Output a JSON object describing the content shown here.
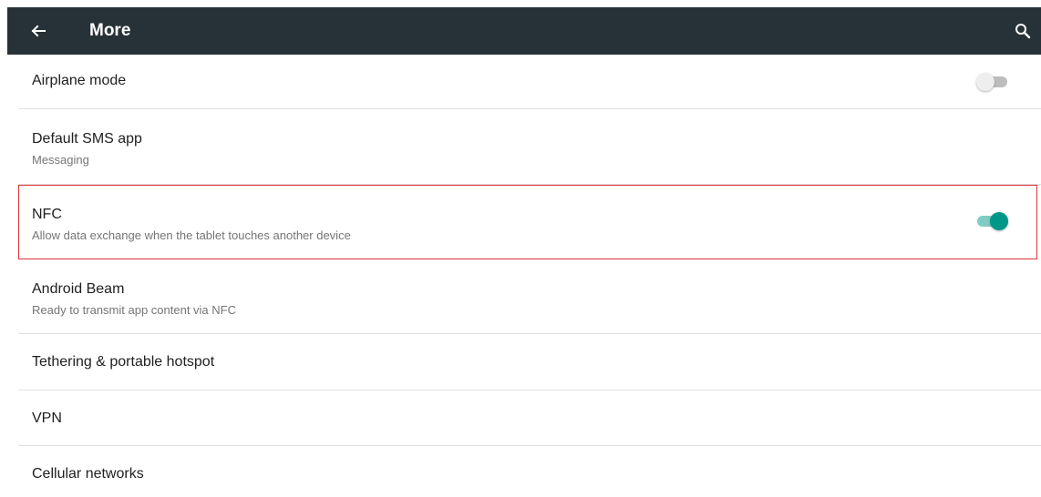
{
  "toolbar": {
    "title": "More",
    "back_icon": "arrow-back-icon",
    "search_icon": "search-icon",
    "background_color": "#263238"
  },
  "items": [
    {
      "title": "Airplane mode",
      "subtitle": "",
      "toggle": "off"
    },
    {
      "title": "Default SMS app",
      "subtitle": "Messaging"
    },
    {
      "title": "NFC",
      "subtitle": "Allow data exchange when the tablet touches another device",
      "toggle": "on"
    },
    {
      "title": "Android Beam",
      "subtitle": "Ready to transmit app content via NFC"
    },
    {
      "title": "Tethering & portable hotspot"
    },
    {
      "title": "VPN"
    },
    {
      "title": "Cellular networks"
    }
  ],
  "colors": {
    "accent": "#009688",
    "highlight_border": "#e0323a"
  }
}
